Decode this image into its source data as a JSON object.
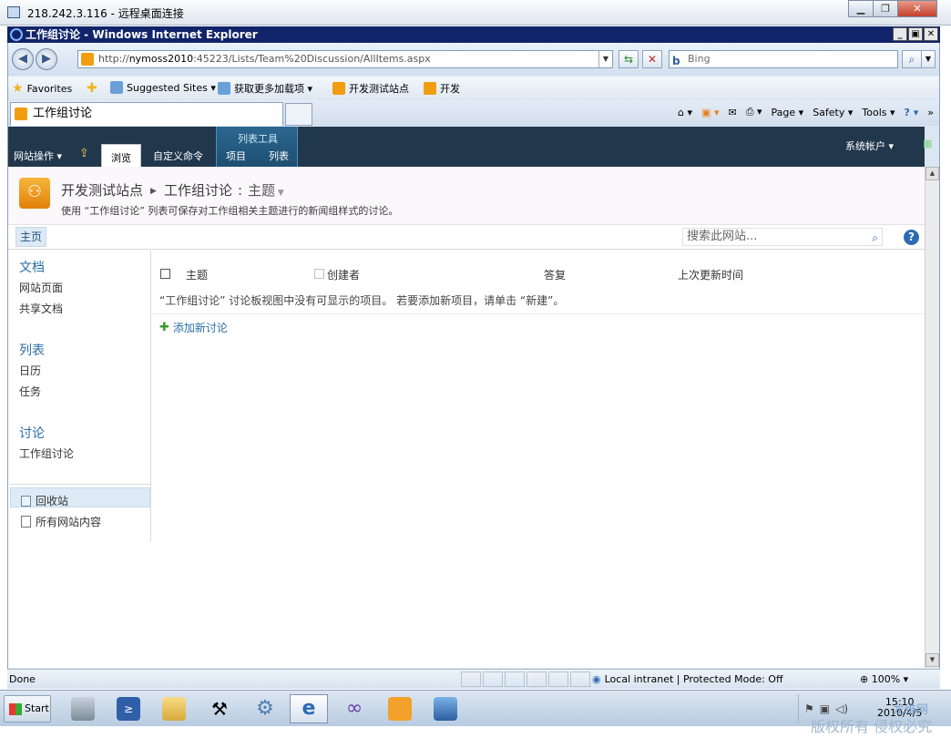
{
  "rdp": {
    "title": "218.242.3.116 - 远程桌面连接"
  },
  "ie": {
    "title": "工作组讨论 - Windows Internet Explorer",
    "url_prefix": "http://",
    "url_host": "nymoss2010",
    "url_rest": ":45223/Lists/Team%20Discussion/AllItems.aspx",
    "search_placeholder": "Bing",
    "favorites": {
      "label": "Favorites",
      "items": [
        "Suggested Sites ▾",
        "获取更多加载项 ▾",
        "开发测试站点",
        "开发"
      ]
    },
    "tab_title": "工作组讨论",
    "commands": [
      "Page ▾",
      "Safety ▾",
      "Tools ▾"
    ],
    "status": {
      "text": "Done",
      "zone": "Local intranet | Protected Mode: Off",
      "zoom": "100%"
    }
  },
  "ribbon": {
    "site_actions": "网站操作 ▾",
    "tabs": {
      "browse": "浏览",
      "custom": "自定义命令",
      "items": "项目",
      "list": "列表"
    },
    "context_title": "列表工具",
    "user": "系统帐户 ▾"
  },
  "titlebar": {
    "crumb_site": "开发测试站点",
    "crumb_list": "工作组讨论",
    "crumb_view": "主题",
    "description": "使用 “工作组讨论” 列表可保存对工作组相关主题进行的新闻组样式的讨论。"
  },
  "topnav": {
    "home": "主页",
    "search_placeholder": "搜索此网站..."
  },
  "quicklaunch": {
    "sections": [
      {
        "heading": "文档",
        "items": [
          "网站页面",
          "共享文档"
        ]
      },
      {
        "heading": "列表",
        "items": [
          "日历",
          "任务"
        ]
      },
      {
        "heading": "讨论",
        "items": [
          "工作组讨论"
        ]
      }
    ],
    "recycle_bin": "回收站",
    "all_content": "所有网站内容"
  },
  "list": {
    "columns": [
      "主题",
      "创建者",
      "答复",
      "上次更新时间"
    ],
    "empty_message": "“工作组讨论” 讨论板视图中没有可显示的项目。 若要添加新项目，请单击 “新建”。",
    "add_new": "添加新讨论"
  },
  "taskbar": {
    "start": "Start",
    "time": "15:10",
    "date": "2010/4/5"
  },
  "watermark": {
    "text": "版权所有 侵权必究",
    "brand": "龙维网"
  }
}
